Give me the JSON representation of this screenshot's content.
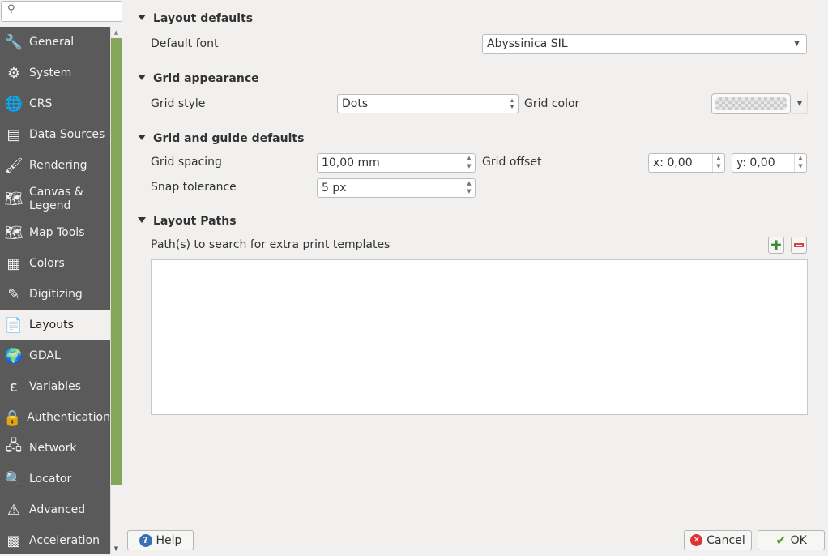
{
  "sidebar": {
    "search_placeholder": "",
    "items": [
      {
        "label": "General",
        "icon": "🔧"
      },
      {
        "label": "System",
        "icon": "⚙"
      },
      {
        "label": "CRS",
        "icon": "🌐"
      },
      {
        "label": "Data Sources",
        "icon": "▤"
      },
      {
        "label": "Rendering",
        "icon": "🖌"
      },
      {
        "label": "Canvas & Legend",
        "icon": "🗺"
      },
      {
        "label": "Map Tools",
        "icon": "🗺"
      },
      {
        "label": "Colors",
        "icon": "▦"
      },
      {
        "label": "Digitizing",
        "icon": "✎"
      },
      {
        "label": "Layouts",
        "icon": "📄"
      },
      {
        "label": "GDAL",
        "icon": "🌍"
      },
      {
        "label": "Variables",
        "icon": "ε"
      },
      {
        "label": "Authentication",
        "icon": "🔒"
      },
      {
        "label": "Network",
        "icon": "🖧"
      },
      {
        "label": "Locator",
        "icon": "🔍"
      },
      {
        "label": "Advanced",
        "icon": "⚠"
      },
      {
        "label": "Acceleration",
        "icon": "▩"
      }
    ],
    "selected": "Layouts"
  },
  "sections": {
    "layout_defaults": {
      "title": "Layout defaults",
      "default_font_label": "Default font",
      "default_font_value": "Abyssinica SIL"
    },
    "grid_appearance": {
      "title": "Grid appearance",
      "grid_style_label": "Grid style",
      "grid_style_value": "Dots",
      "grid_color_label": "Grid color"
    },
    "grid_guide": {
      "title": "Grid and guide defaults",
      "grid_spacing_label": "Grid spacing",
      "grid_spacing_value": "10,00 mm",
      "grid_offset_label": "Grid offset",
      "offset_x": "x: 0,00",
      "offset_y": "y: 0,00",
      "snap_label": "Snap tolerance",
      "snap_value": "5 px"
    },
    "layout_paths": {
      "title": "Layout Paths",
      "paths_label": "Path(s) to search for extra print templates"
    }
  },
  "buttons": {
    "help": "Help",
    "cancel": "Cancel",
    "ok": "OK"
  }
}
